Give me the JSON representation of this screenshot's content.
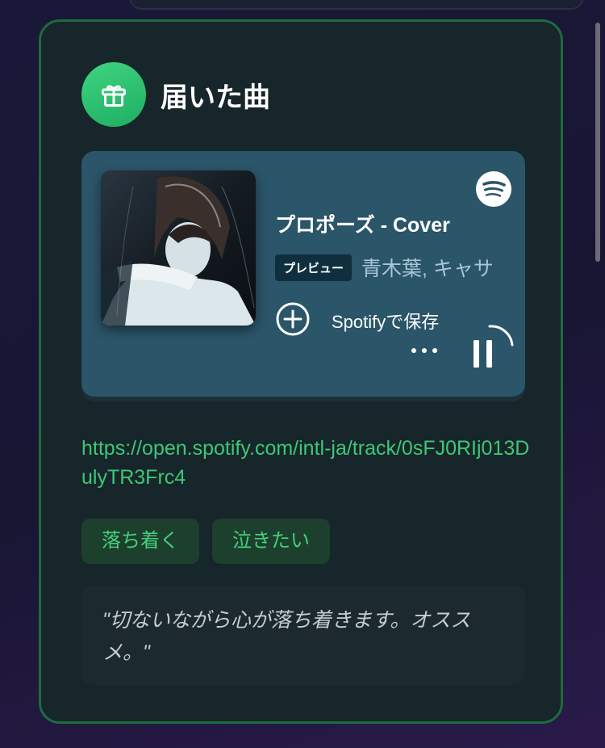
{
  "section": {
    "title": "届いた曲",
    "icon": "gift-icon"
  },
  "player": {
    "brand_icon": "spotify-icon",
    "track_title": "プロポーズ - Cover",
    "preview_badge": "プレビュー",
    "artist": "青木葉, キャサ",
    "save_label": "Spotifyで保存",
    "add_icon": "plus-circle-icon",
    "more_icon": "more-horizontal-icon",
    "play_state_icon": "pause-icon",
    "colors": {
      "background": "#2b5569",
      "badge": "#0f2f3f"
    }
  },
  "link": {
    "url": "https://open.spotify.com/intl-ja/track/0sFJ0RIj013DulyTR3Frc4"
  },
  "tags": [
    "落ち着く",
    "泣きたい"
  ],
  "comment": {
    "text": "\"切ないながら心が落ち着きます。オススメ。\""
  },
  "colors": {
    "accent_green": "#3ec777",
    "card_border": "#1e6b3c",
    "card_background": "#16262a"
  }
}
